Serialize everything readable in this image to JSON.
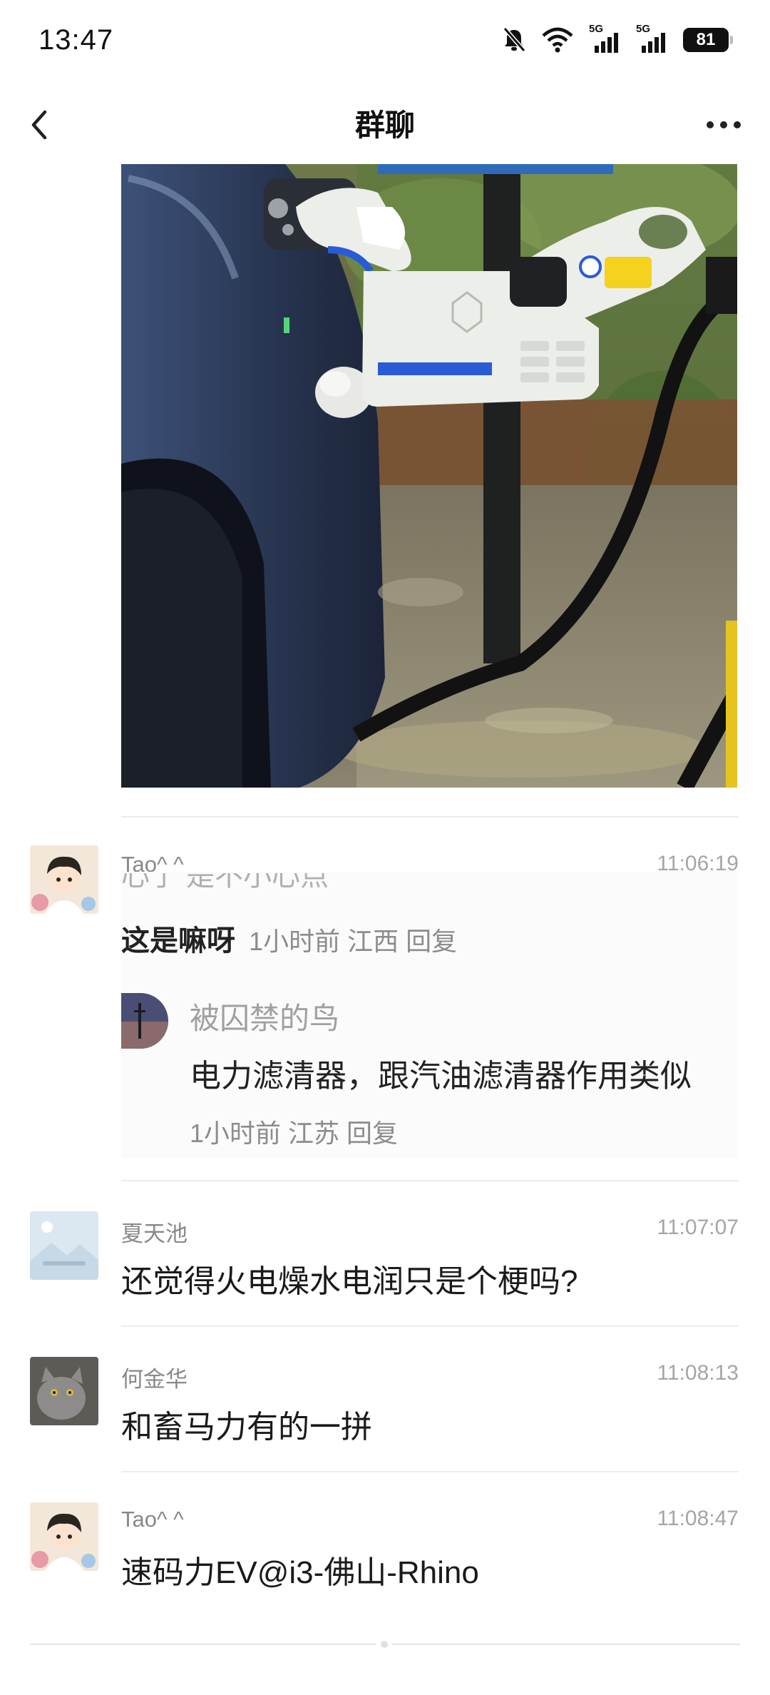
{
  "status_bar": {
    "time": "13:47",
    "icons": [
      "mute-icon",
      "wifi-icon",
      "signal-5g-icon",
      "signal-5g-icon",
      "battery-icon"
    ],
    "signal_tag_1": "5G",
    "signal_tag_2": "5G",
    "battery_level": "81"
  },
  "nav": {
    "title": "群聊",
    "back_icon": "chevron-left-icon",
    "more_icon": "more-dots-icon"
  },
  "messages": [
    {
      "sender": "Tao^ ^",
      "time": "11:06:19",
      "quote": {
        "cut_line": "心了 是不小心点",
        "main_text": "这是嘛呀",
        "main_meta": "1小时前  江西  回复",
        "reply_user": "被囚禁的鸟",
        "reply_text": "电力滤清器，跟汽油滤清器作用类似",
        "reply_meta": "1小时前  江苏  回复"
      }
    },
    {
      "sender": "夏天池",
      "time": "11:07:07",
      "text": "还觉得火电燥水电润只是个梗吗?"
    },
    {
      "sender": "何金华",
      "time": "11:08:13",
      "text": "和畜马力有的一拼"
    },
    {
      "sender": "Tao^ ^",
      "time": "11:08:47",
      "text": "速码力EV@i3-佛山-Rhino"
    }
  ],
  "colors": {
    "accent_blue": "#2a5bd7",
    "charger_white": "#eceee9",
    "car_blue": "#27344f",
    "text_primary": "#1a1a1a",
    "text_secondary": "#888888"
  }
}
